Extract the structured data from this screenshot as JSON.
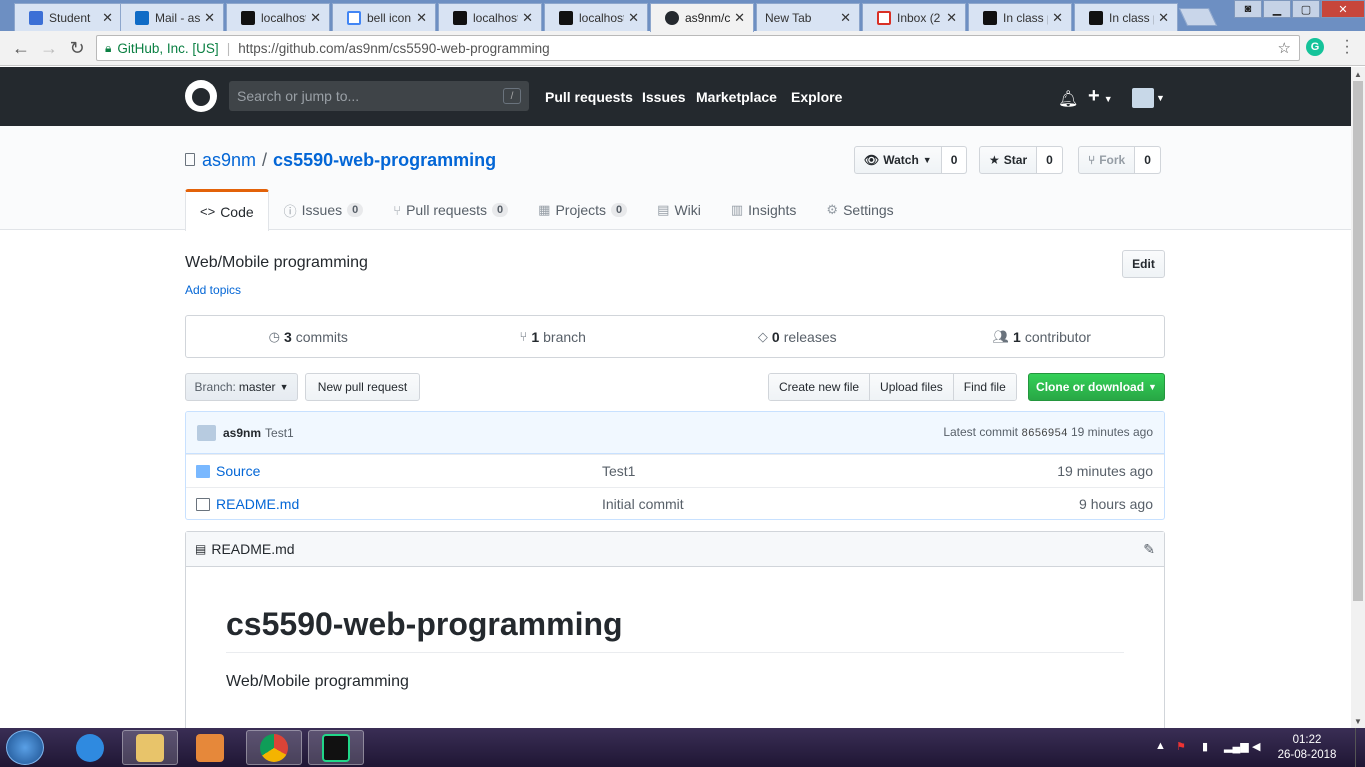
{
  "browser": {
    "tabs": [
      {
        "label": "Student",
        "favicon": "student-icon"
      },
      {
        "label": "Mail - as",
        "favicon": "outlook-icon"
      },
      {
        "label": "localhost",
        "favicon": "webstorm-icon"
      },
      {
        "label": "bell icon",
        "favicon": "google-icon"
      },
      {
        "label": "localhost",
        "favicon": "webstorm-icon"
      },
      {
        "label": "localhost",
        "favicon": "webstorm-icon"
      },
      {
        "label": "as9nm/c",
        "favicon": "github-icon",
        "active": true
      },
      {
        "label": "New Tab",
        "favicon": ""
      },
      {
        "label": "Inbox (2",
        "favicon": "gmail-icon"
      },
      {
        "label": "In class p",
        "favicon": "webstorm-icon"
      },
      {
        "label": "In class p",
        "favicon": "webstorm-icon"
      }
    ],
    "omnibox": {
      "org": "GitHub, Inc. [US]",
      "url": "https://github.com/as9nm/cs5590-web-programming"
    }
  },
  "github": {
    "search_placeholder": "Search or jump to...",
    "search_shortcut": "/",
    "nav": [
      "Pull requests",
      "Issues",
      "Marketplace",
      "Explore"
    ]
  },
  "repo": {
    "owner": "as9nm",
    "name": "cs5590-web-programming",
    "watch": {
      "label": "Watch",
      "count": "0"
    },
    "star": {
      "label": "Star",
      "count": "0"
    },
    "fork": {
      "label": "Fork",
      "count": "0"
    },
    "tabs": [
      {
        "label": "Code",
        "count": null,
        "icon": "code-icon"
      },
      {
        "label": "Issues",
        "count": "0",
        "icon": "issue-icon"
      },
      {
        "label": "Pull requests",
        "count": "0",
        "icon": "pull-request-icon"
      },
      {
        "label": "Projects",
        "count": "0",
        "icon": "project-icon"
      },
      {
        "label": "Wiki",
        "count": null,
        "icon": "book-icon"
      },
      {
        "label": "Insights",
        "count": null,
        "icon": "graph-icon"
      },
      {
        "label": "Settings",
        "count": null,
        "icon": "gear-icon"
      }
    ],
    "description": "Web/Mobile programming",
    "add_topics": "Add topics",
    "edit": "Edit",
    "summary": {
      "commits_num": "3",
      "commits_label": "commits",
      "branch_num": "1",
      "branch_label": "branch",
      "releases_num": "0",
      "releases_label": "releases",
      "contributors_num": "1",
      "contributors_label": "contributor"
    },
    "branch_button": {
      "prefix": "Branch:",
      "value": "master"
    },
    "new_pr": "New pull request",
    "file_buttons": [
      "Create new file",
      "Upload files",
      "Find file"
    ],
    "clone": "Clone or download",
    "commit": {
      "author": "as9nm",
      "message": "Test1",
      "latest_label": "Latest commit",
      "sha": "8656954",
      "age": "19 minutes ago"
    },
    "files": [
      {
        "name": "Source",
        "type": "folder",
        "message": "Test1",
        "age": "19 minutes ago"
      },
      {
        "name": "README.md",
        "type": "file",
        "message": "Initial commit",
        "age": "9 hours ago"
      }
    ],
    "readme": {
      "filename": "README.md",
      "heading": "cs5590-web-programming",
      "body": "Web/Mobile programming"
    }
  },
  "taskbar": {
    "time": "01:22",
    "date": "26-08-2018"
  },
  "colors": {
    "github_header": "#24292e",
    "link": "#0366d6",
    "clone_green": "#28a745",
    "tab_accent": "#e36209"
  }
}
